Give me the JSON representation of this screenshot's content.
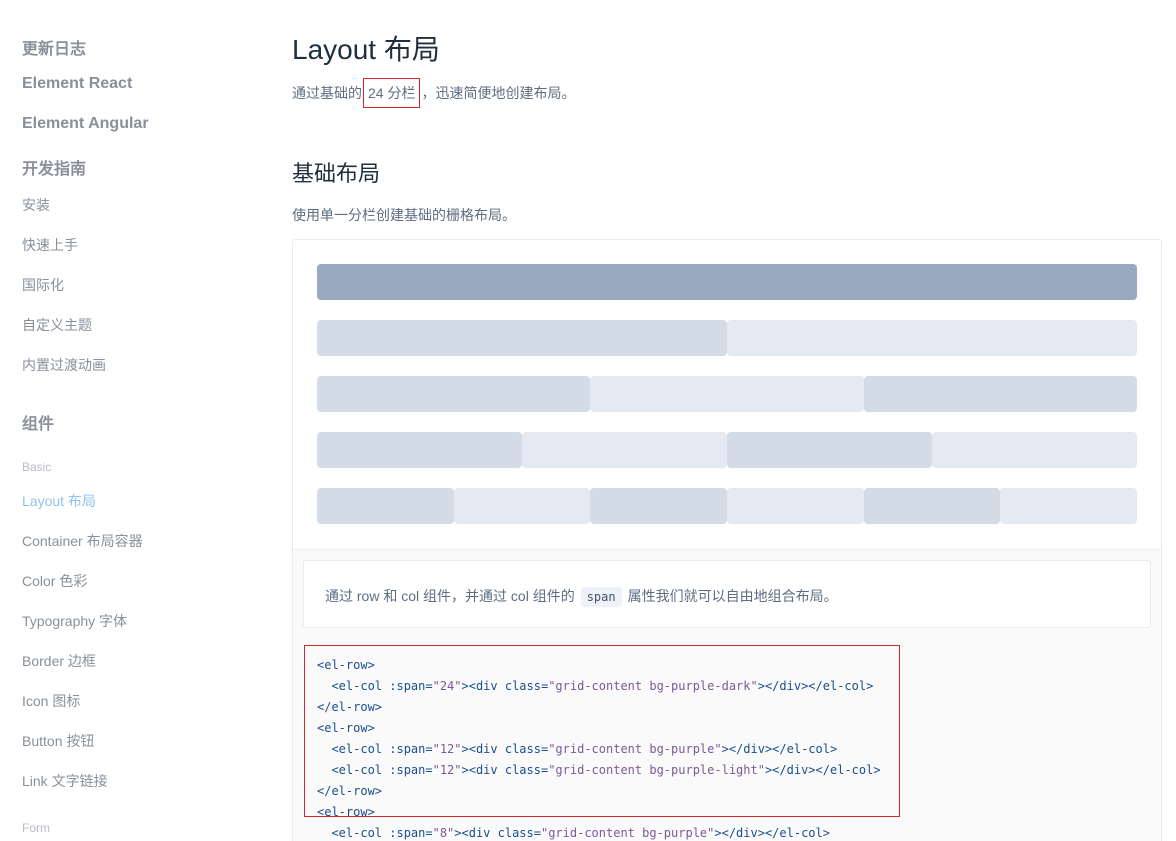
{
  "sidebar": {
    "groups": [
      {
        "label": "更新日志"
      },
      {
        "label": "Element React"
      },
      {
        "label": "Element Angular"
      },
      {
        "label": "开发指南"
      }
    ],
    "guide_items": [
      "安装",
      "快速上手",
      "国际化",
      "自定义主题",
      "内置过渡动画"
    ],
    "components_title": "组件",
    "basic_category": "Basic",
    "basic_items": [
      "Layout 布局",
      "Container 布局容器",
      "Color 色彩",
      "Typography 字体",
      "Border 边框",
      "Icon 图标",
      "Button 按钮",
      "Link 文字链接"
    ],
    "active_item": "Layout 布局",
    "form_category": "Form"
  },
  "main": {
    "title": "Layout 布局",
    "intro_before": "通过基础的",
    "intro_highlight": "24 分栏",
    "intro_after": "，迅速简便地创建布局。",
    "section_title": "基础布局",
    "section_desc": "使用单一分栏创建基础的栅格布局。",
    "demo_description_before": "通过 row 和 col 组件，并通过 col 组件的",
    "demo_description_code": "span",
    "demo_description_after": "属性我们就可以自由地组合布局。",
    "code_lines": [
      "<el-row>",
      "  <el-col :span=\"24\"><div class=\"grid-content bg-purple-dark\"></div></el-col>",
      "</el-row>",
      "<el-row>",
      "  <el-col :span=\"12\"><div class=\"grid-content bg-purple\"></div></el-col>",
      "  <el-col :span=\"12\"><div class=\"grid-content bg-purple-light\"></div></el-col>",
      "</el-row>",
      "<el-row>",
      "  <el-col :span=\"8\"><div class=\"grid-content bg-purple\"></div></el-col>"
    ]
  },
  "grid_rows": [
    {
      "spans": [
        24
      ]
    },
    {
      "spans": [
        12,
        12
      ]
    },
    {
      "spans": [
        8,
        8,
        8
      ]
    },
    {
      "spans": [
        6,
        6,
        6,
        6
      ]
    },
    {
      "spans": [
        4,
        4,
        4,
        4,
        4,
        4
      ]
    }
  ],
  "colors": {
    "bg_purple_dark": "#99a9bf",
    "bg_purple": "#d3dce6",
    "bg_purple_light": "#e5e9f2",
    "active_link": "#8fc3ee",
    "highlight_border": "#d9252c"
  }
}
